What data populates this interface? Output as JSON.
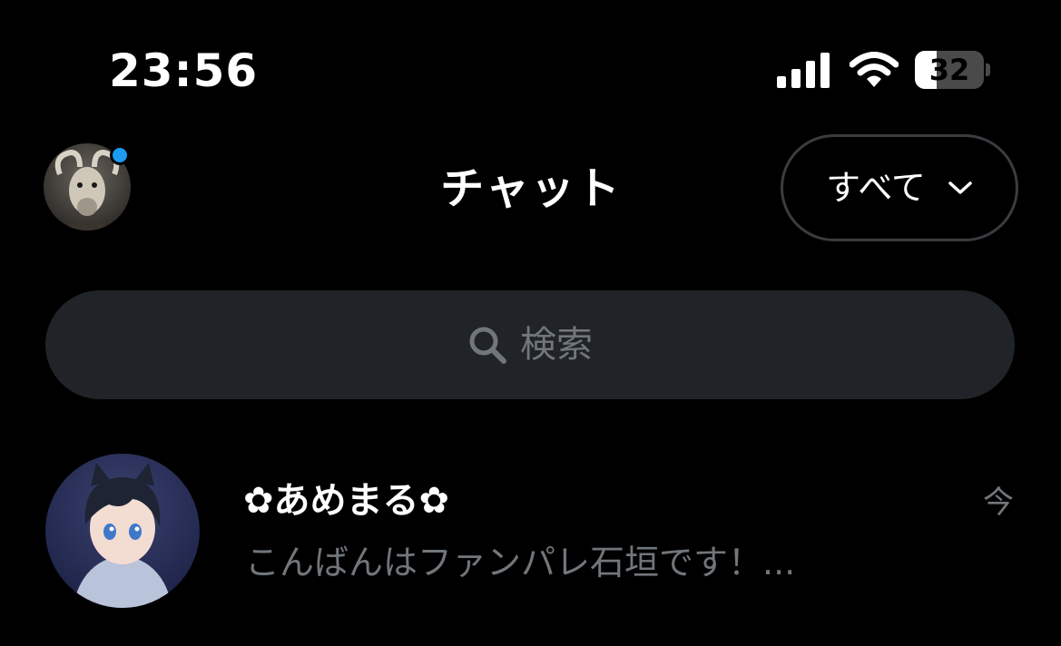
{
  "status_bar": {
    "time": "23:56",
    "battery_level": "32",
    "battery_fraction": 0.32,
    "icons": [
      "cellular-signal-icon",
      "wifi-icon",
      "battery-icon"
    ]
  },
  "header": {
    "title": "チャット",
    "filter": {
      "label": "すべて",
      "icon": "chevron-down-icon"
    },
    "profile_online": true
  },
  "search": {
    "placeholder": "検索",
    "icon": "search-icon"
  },
  "chats": [
    {
      "name": "✿あめまる✿",
      "time": "今",
      "preview": "こんばんはファンパレ石垣です！..."
    }
  ],
  "colors": {
    "background": "#000000",
    "search_background": "#202327",
    "muted_text": "#71767b",
    "accent_blue": "#1d9bf0",
    "filter_border": "#3a3c40"
  }
}
